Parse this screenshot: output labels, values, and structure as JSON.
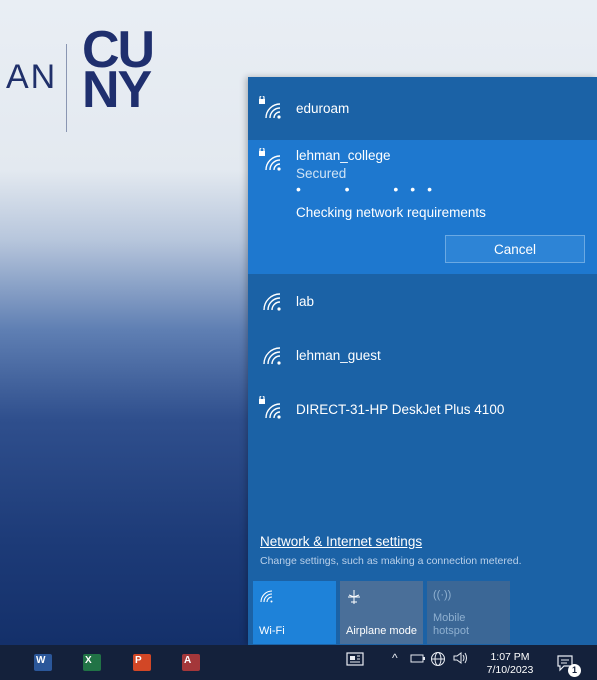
{
  "desktop": {
    "logo_partial": "AN",
    "logo_line1": "CU",
    "logo_line2": "NY"
  },
  "networks": [
    {
      "name": "eduroam",
      "secured_icon": true
    },
    {
      "name": "lehman_college",
      "status": "Secured",
      "secured_icon": true,
      "progress_text": "Checking network requirements",
      "cancel_label": "Cancel"
    },
    {
      "name": "lab",
      "secured_icon": false
    },
    {
      "name": "lehman_guest",
      "secured_icon": false
    },
    {
      "name": "DIRECT-31-HP DeskJet Plus 4100",
      "secured_icon": true
    }
  ],
  "settings": {
    "link": "Network & Internet settings",
    "sub": "Change settings, such as making a connection metered."
  },
  "quick_actions": [
    {
      "label": "Wi-Fi",
      "icon": "wifi-icon",
      "active": true
    },
    {
      "label": "Airplane mode",
      "icon": "airplane-icon",
      "active": false
    },
    {
      "label_line1": "Mobile",
      "label_line2": "hotspot",
      "icon": "hotspot-icon",
      "disabled": true
    }
  ],
  "taskbar": {
    "apps": [
      {
        "name": "word",
        "letter": "W",
        "color": "#2b579a"
      },
      {
        "name": "excel",
        "letter": "X",
        "color": "#217346"
      },
      {
        "name": "powerpoint",
        "letter": "P",
        "color": "#d24726"
      },
      {
        "name": "access",
        "letter": "A",
        "color": "#a4373a"
      }
    ],
    "time": "1:07 PM",
    "date": "7/10/2023",
    "notification_count": "1"
  }
}
